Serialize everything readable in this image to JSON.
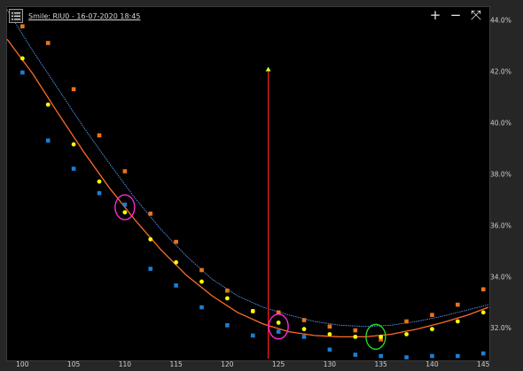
{
  "window": {
    "title": "Smile: RIU0 - 16-07-2020 18:45",
    "menu_icon": "list-icon",
    "tools": [
      {
        "name": "zoom-in",
        "glyph": "+"
      },
      {
        "name": "zoom-out",
        "glyph": "−"
      },
      {
        "name": "fit",
        "glyph": "⤧"
      }
    ]
  },
  "chart_data": {
    "type": "scatter",
    "title": "Smile: RIU0 - 16-07-2020 18:45",
    "xlim": [
      98.5,
      145.5
    ],
    "ylim": [
      30.8,
      44.5
    ],
    "x_ticks": [
      100,
      105,
      110,
      115,
      120,
      125,
      130,
      135,
      140,
      145
    ],
    "y_ticks": [
      32,
      34,
      36,
      38,
      40,
      42,
      44
    ],
    "x_tick_labels": [
      "100",
      "105",
      "110",
      "115",
      "120",
      "125",
      "130",
      "135",
      "140",
      "145"
    ],
    "y_tick_labels": [
      "32.0%",
      "34.0%",
      "36.0%",
      "38.0%",
      "40.0%",
      "42.0%",
      "44.0%"
    ],
    "y_axis_position": "right",
    "grid": false,
    "colors": {
      "ask": "#e8741b",
      "bid": "#1a7fd4",
      "mid": "#ffff00",
      "fit_curve": "#ff6a2a",
      "upper_curve": "#5a9bff",
      "strike_line": "#ff1a1a",
      "strike_marker": "#c8ff3a",
      "highlight_magenta": "#ff2bd6",
      "highlight_green": "#22dd22"
    },
    "series": [
      {
        "x": [
          100,
          102.5,
          105,
          107.5,
          110,
          112.5,
          115,
          117.5,
          120,
          122.5,
          125,
          127.5,
          130,
          132.5,
          135,
          137.5,
          140,
          142.5,
          145
        ],
        "values": [
          43.75,
          43.1,
          41.3,
          39.5,
          38.1,
          36.45,
          35.35,
          34.25,
          33.45,
          32.65,
          32.6,
          32.3,
          32.05,
          31.9,
          31.55,
          32.25,
          32.5,
          32.9,
          33.5
        ]
      },
      {
        "x": [
          100,
          102.5,
          105,
          107.5,
          110,
          112.5,
          115,
          117.5,
          120,
          122.5,
          125,
          127.5,
          130,
          132.5,
          135,
          137.5,
          140,
          142.5,
          145
        ],
        "values": [
          41.95,
          39.3,
          38.2,
          37.25,
          36.8,
          34.3,
          33.65,
          32.8,
          32.1,
          31.7,
          31.85,
          31.65,
          31.15,
          30.95,
          30.9,
          30.85,
          30.9,
          30.9,
          31.0
        ]
      },
      {
        "x": [
          100,
          102.5,
          105,
          107.5,
          110,
          112.5,
          115,
          117.5,
          120,
          122.5,
          125,
          127.5,
          130,
          132.5,
          135,
          137.5,
          140,
          142.5,
          145
        ],
        "values": [
          42.5,
          40.7,
          39.15,
          37.7,
          36.5,
          35.45,
          34.55,
          33.8,
          33.15,
          32.65,
          32.2,
          31.95,
          31.75,
          31.65,
          31.65,
          31.75,
          31.95,
          32.25,
          32.6
        ]
      }
    ],
    "fit_curve": {
      "x": [
        98.5,
        101,
        103.5,
        106,
        108.5,
        111,
        113.5,
        116,
        118.5,
        121,
        123.5,
        126,
        128.5,
        131,
        133.5,
        136,
        138.5,
        141,
        143.5,
        145.5
      ],
      "values": [
        43.25,
        41.9,
        40.35,
        38.85,
        37.45,
        36.2,
        35.05,
        34.05,
        33.25,
        32.6,
        32.15,
        31.85,
        31.7,
        31.65,
        31.65,
        31.75,
        31.95,
        32.2,
        32.5,
        32.8
      ]
    },
    "upper_curve": {
      "x": [
        98.5,
        101,
        103.5,
        106,
        108.5,
        111,
        113.5,
        116,
        118.5,
        121,
        123.5,
        126,
        128.5,
        131,
        133.5,
        136,
        138.5,
        141,
        143.5,
        145.5
      ],
      "values": [
        44.4,
        42.8,
        41.3,
        39.8,
        38.4,
        37.05,
        35.85,
        34.8,
        33.9,
        33.25,
        32.8,
        32.5,
        32.25,
        32.1,
        32.05,
        32.1,
        32.25,
        32.45,
        32.7,
        32.9
      ]
    },
    "strike_line": {
      "x": 124,
      "y_top": 42.0
    },
    "highlights": [
      {
        "x": 110,
        "y": 36.7,
        "color": "magenta"
      },
      {
        "x": 125,
        "y": 32.05,
        "color": "magenta"
      },
      {
        "x": 134.5,
        "y": 31.65,
        "color": "green"
      }
    ]
  }
}
